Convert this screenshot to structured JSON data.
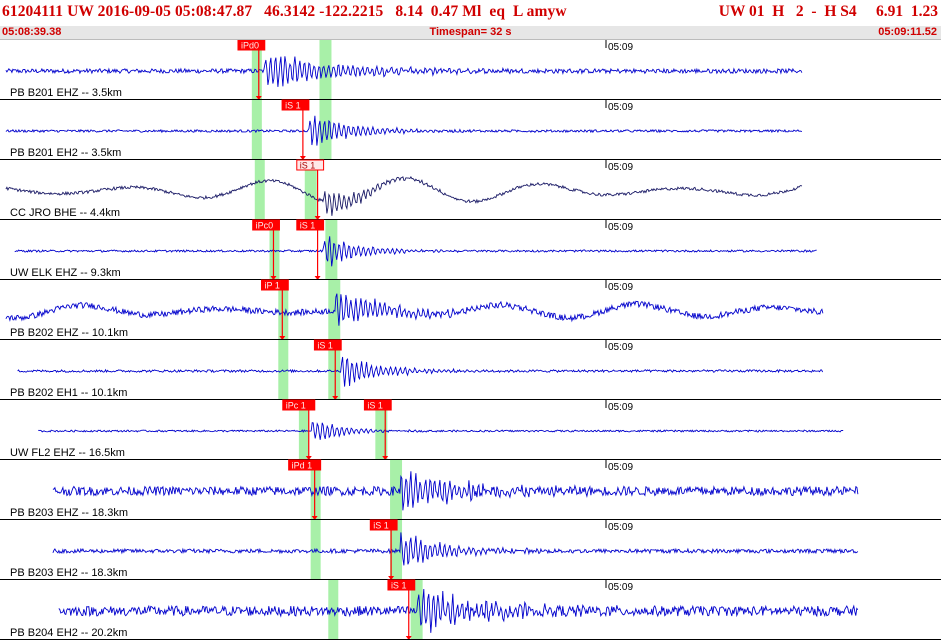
{
  "header": {
    "event_info": "61204111 UW 2016-09-05 05:08:47.87   46.3142 -122.2215   8.14  0.47 Ml  eq  L amyw",
    "station_info": "UW 01  H   2  -  H S4     6.91  1.23",
    "time_start": "05:08:39.38",
    "timespan": "Timespan=  32 s",
    "time_end": "05:09:11.52"
  },
  "colors": {
    "header_text": "#d00000",
    "trace": "#0000cc",
    "trace_dark": "#1a1a66",
    "pick_window": "#a8f0a8",
    "pick_label": "#ff0000",
    "pick_label_hollow": "#ffe8e8",
    "pick_line": "#ff0000",
    "separator": "#000000"
  },
  "tick_label": "05:09",
  "channels": [
    {
      "label": "PB B201 EHZ -- 3.5km",
      "color": "trace",
      "picks": [
        {
          "label": "iPd0",
          "t": 8.8,
          "hollow": false
        }
      ],
      "windows": [
        8.7,
        11.0
      ],
      "wave": {
        "start": 0.2,
        "end": 27.3,
        "noise": 2.2,
        "arrival": 9.0,
        "amp": 18,
        "decay": 2.5,
        "osc": 0
      }
    },
    {
      "label": "PB B201 EH2 -- 3.5km",
      "color": "trace",
      "picks": [
        {
          "label": "iS 1",
          "t": 10.3,
          "hollow": false
        }
      ],
      "windows": [
        8.7,
        11.0
      ],
      "wave": {
        "start": 0.2,
        "end": 27.3,
        "noise": 1.2,
        "arrival": 10.5,
        "amp": 16,
        "decay": 1.5,
        "osc": 0
      }
    },
    {
      "label": "CC JRO BHE -- 4.4km",
      "color": "trace_dark",
      "picks": [
        {
          "label": "iS 1",
          "t": 10.8,
          "hollow": true
        }
      ],
      "windows": [
        8.8,
        10.5
      ],
      "wave": {
        "start": 0.2,
        "end": 27.3,
        "noise": 1.5,
        "arrival": 11.0,
        "amp": 14,
        "decay": 1.2,
        "osc": 13
      }
    },
    {
      "label": "UW ELK EHZ -- 9.3km",
      "color": "trace",
      "picks": [
        {
          "label": "iPc0",
          "t": 9.3,
          "hollow": false
        },
        {
          "label": "iS 1",
          "t": 10.8,
          "hollow": false
        }
      ],
      "windows": [
        9.3,
        11.2
      ],
      "wave": {
        "start": 0.5,
        "end": 27.8,
        "noise": 1.0,
        "arrival": 11.0,
        "amp": 16,
        "decay": 1.2,
        "osc": 0
      }
    },
    {
      "label": "PB B202 EHZ -- 10.1km",
      "color": "trace",
      "picks": [
        {
          "label": "iP 1",
          "t": 9.6,
          "hollow": false
        }
      ],
      "windows": [
        9.6,
        11.3
      ],
      "wave": {
        "start": 0.2,
        "end": 28.0,
        "noise": 3.0,
        "arrival": 11.4,
        "amp": 18,
        "decay": 1.8,
        "osc": 7
      }
    },
    {
      "label": "PB B202 EH1 -- 10.1km",
      "color": "trace",
      "picks": [
        {
          "label": "iS 1",
          "t": 11.4,
          "hollow": false
        }
      ],
      "windows": [
        9.6,
        11.3
      ],
      "wave": {
        "start": 0.6,
        "end": 28.0,
        "noise": 1.2,
        "arrival": 11.6,
        "amp": 15,
        "decay": 1.3,
        "osc": 0
      }
    },
    {
      "label": "UW FL2 EHZ -- 16.5km",
      "color": "trace",
      "picks": [
        {
          "label": "iPc 1",
          "t": 10.5,
          "hollow": false
        },
        {
          "label": "iS 1",
          "t": 13.1,
          "hollow": false
        }
      ],
      "windows": [
        10.3,
        12.9
      ],
      "wave": {
        "start": 1.3,
        "end": 28.7,
        "noise": 0.9,
        "arrival": 10.6,
        "amp": 12,
        "decay": 1.0,
        "osc": 0
      }
    },
    {
      "label": "PB B203 EHZ -- 18.3km",
      "color": "trace",
      "picks": [
        {
          "label": "iPd 1",
          "t": 10.7,
          "hollow": false
        }
      ],
      "windows": [
        10.7,
        13.4
      ],
      "wave": {
        "start": 1.8,
        "end": 29.2,
        "noise": 4.5,
        "arrival": 13.6,
        "amp": 20,
        "decay": 2.0,
        "osc": 0
      }
    },
    {
      "label": "PB B203 EH2 -- 18.3km",
      "color": "trace",
      "picks": [
        {
          "label": "iS 1",
          "t": 13.3,
          "hollow": false
        }
      ],
      "windows": [
        10.7,
        13.4
      ],
      "wave": {
        "start": 1.8,
        "end": 29.2,
        "noise": 2.0,
        "arrival": 13.6,
        "amp": 18,
        "decay": 1.5,
        "osc": 0
      }
    },
    {
      "label": "PB B204 EH2 -- 20.2km",
      "color": "trace",
      "picks": [
        {
          "label": "iS 1",
          "t": 13.9,
          "hollow": false
        }
      ],
      "windows": [
        11.3,
        14.1
      ],
      "wave": {
        "start": 2.0,
        "end": 29.2,
        "noise": 5.0,
        "arrival": 14.2,
        "amp": 22,
        "decay": 2.0,
        "osc": 0
      }
    }
  ]
}
